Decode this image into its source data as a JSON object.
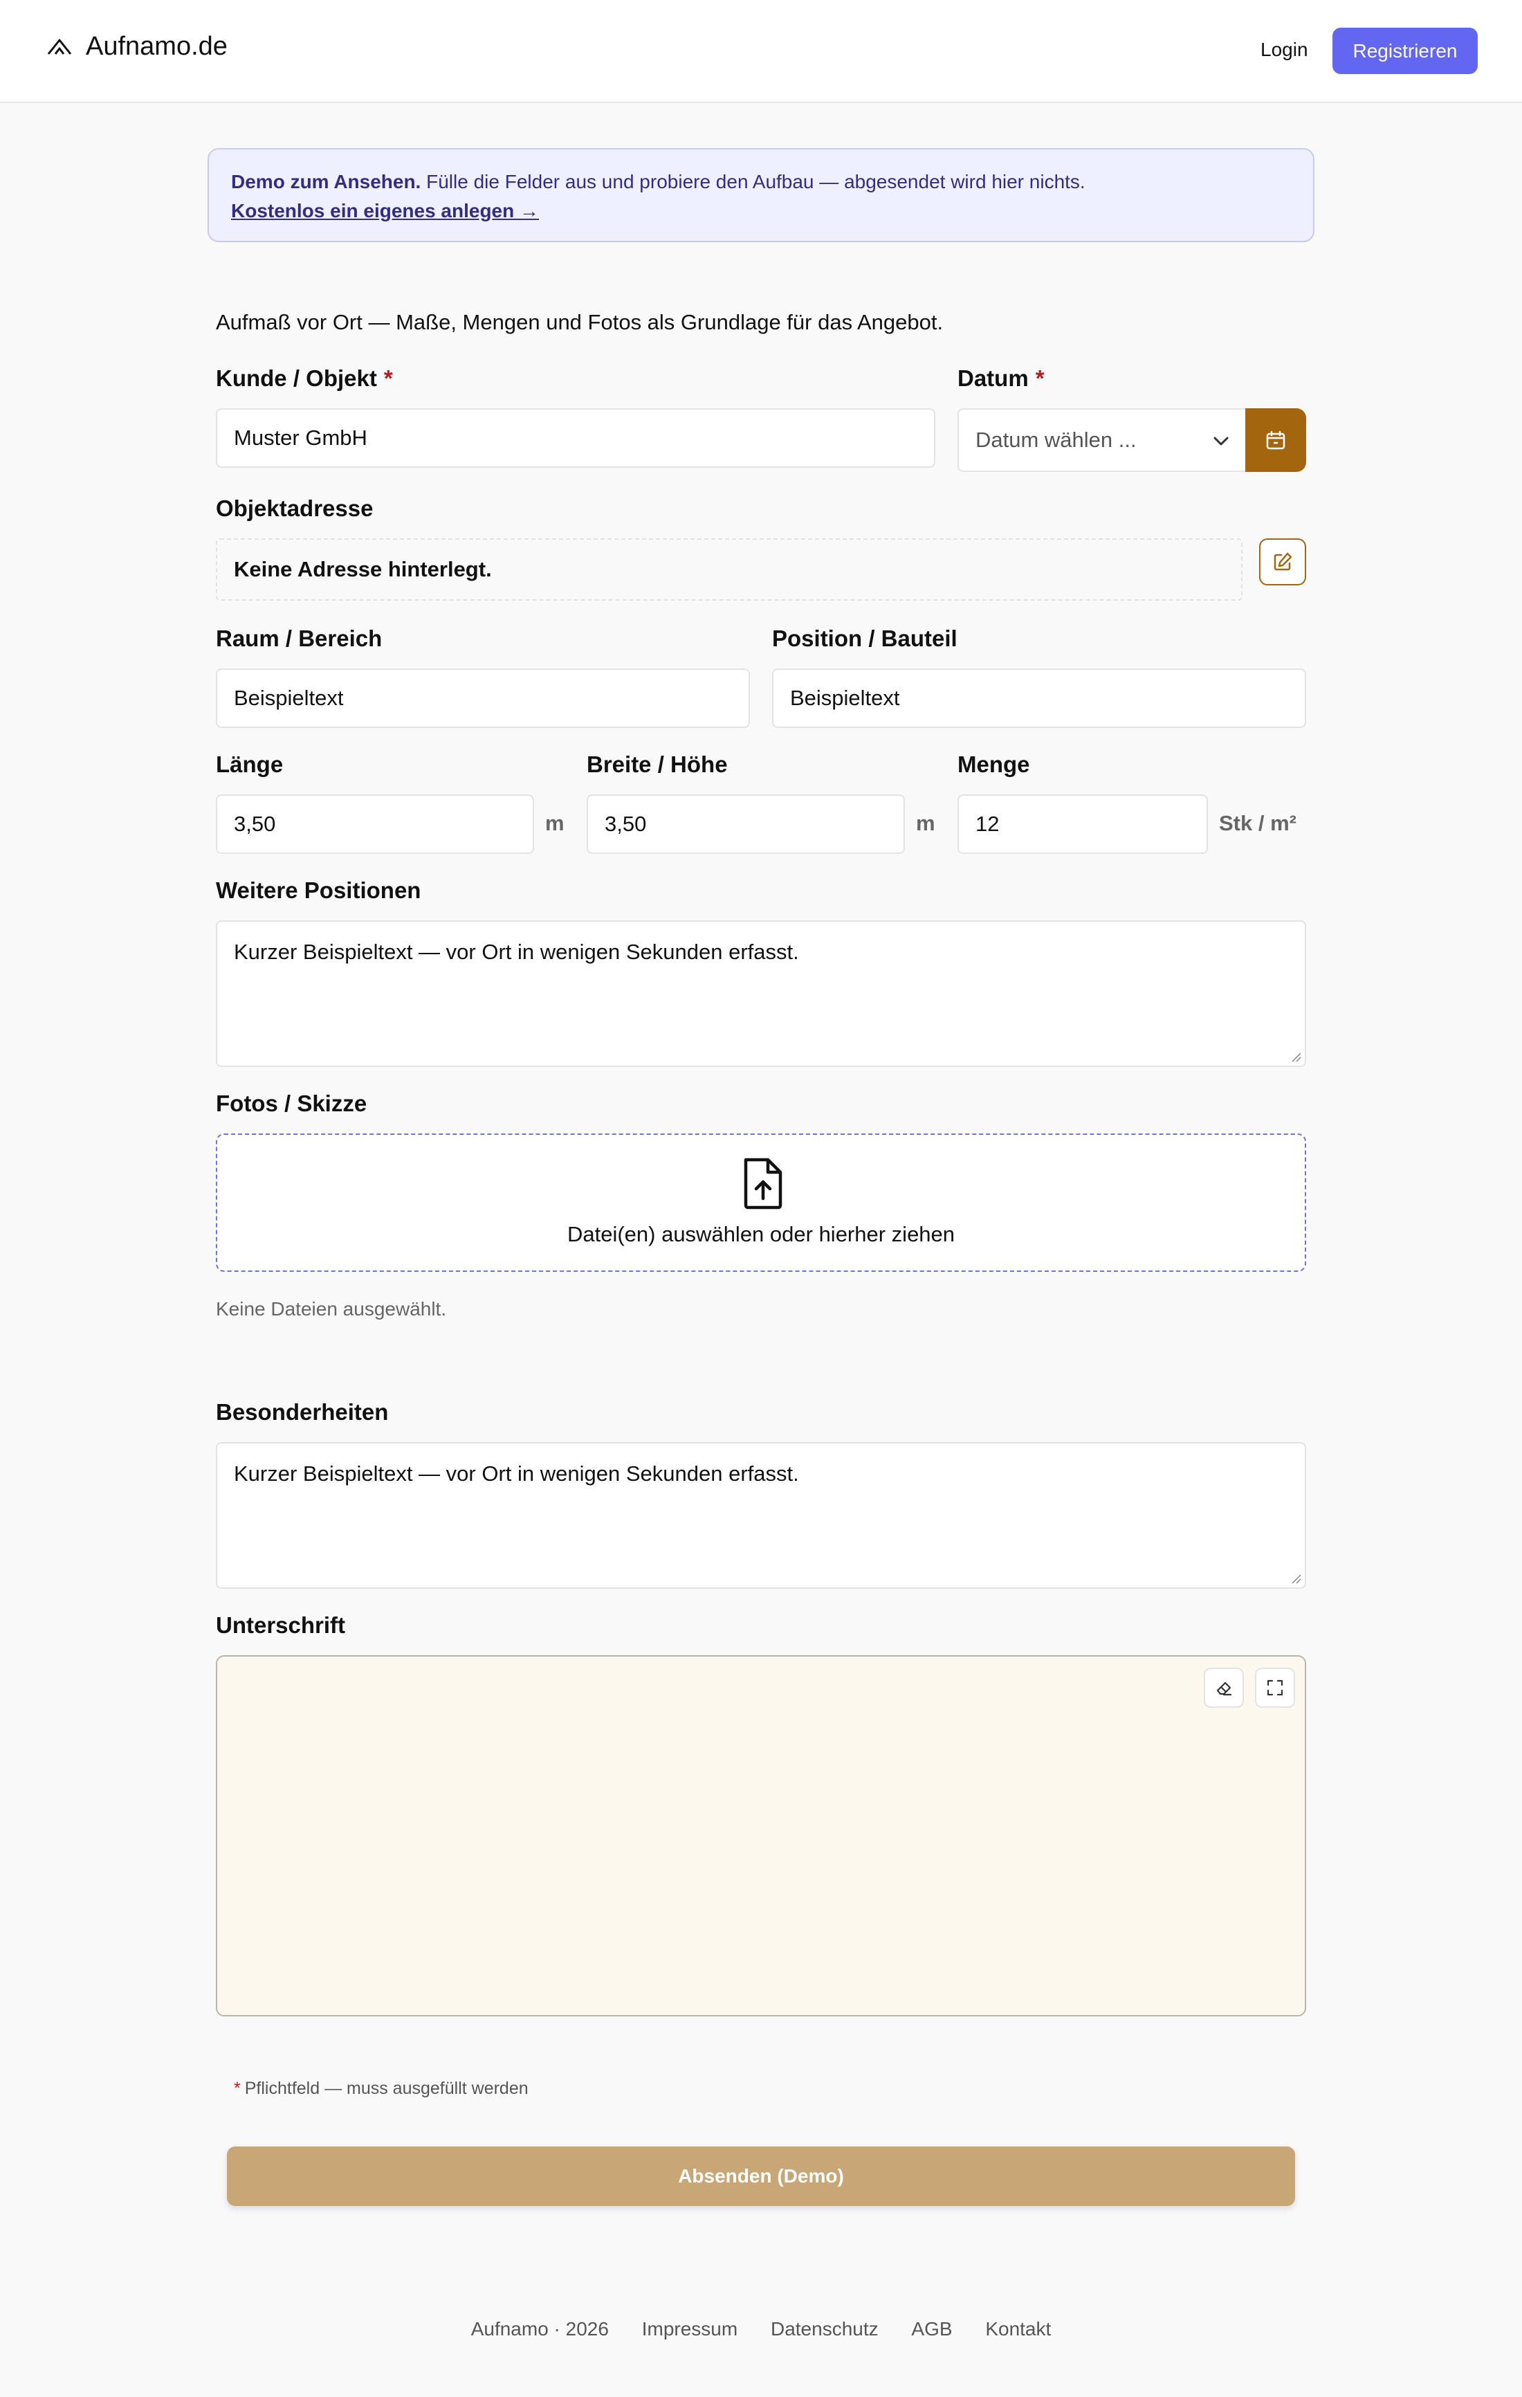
{
  "header": {
    "brand": "Aufnamo.de",
    "login_label": "Login",
    "register_label": "Registrieren"
  },
  "banner": {
    "bold": "Demo zum Ansehen.",
    "text": " Fülle die Felder aus und probiere den Aufbau — abgesendet wird hier nichts.",
    "link": "Kostenlos ein eigenes anlegen →"
  },
  "form": {
    "intro": "Aufmaß vor Ort — Maße, Mengen und Fotos als Grundlage für das Angebot.",
    "required_mark": "*",
    "customer": {
      "label": "Kunde / Objekt",
      "value": "Muster GmbH"
    },
    "date": {
      "label": "Datum",
      "placeholder": "Datum wählen ..."
    },
    "address": {
      "label": "Objektadresse",
      "value": "Keine Adresse hinterlegt."
    },
    "room": {
      "label": "Raum / Bereich",
      "value": "Beispieltext"
    },
    "position": {
      "label": "Position / Bauteil",
      "value": "Beispieltext"
    },
    "length": {
      "label": "Länge",
      "value": "3,50",
      "unit": "m"
    },
    "width": {
      "label": "Breite / Höhe",
      "value": "3,50",
      "unit": "m"
    },
    "quantity": {
      "label": "Menge",
      "value": "12",
      "unit": "Stk / m²"
    },
    "more_positions": {
      "label": "Weitere Positionen",
      "value": "Kurzer Beispieltext — vor Ort in wenigen Sekunden erfasst."
    },
    "photos": {
      "label": "Fotos / Skizze",
      "dropzone_text": "Datei(en) auswählen oder hierher ziehen",
      "status": "Keine Dateien ausgewählt."
    },
    "notes": {
      "label": "Besonderheiten",
      "value": "Kurzer Beispieltext — vor Ort in wenigen Sekunden erfasst."
    },
    "signature": {
      "label": "Unterschrift"
    },
    "required_note": "Pflichtfeld — muss ausgefüllt werden",
    "submit_label": "Absenden (Demo)"
  },
  "footer": {
    "copyright": "Aufnamo · 2026",
    "links": [
      "Impressum",
      "Datenschutz",
      "AGB",
      "Kontakt"
    ]
  },
  "colors": {
    "accent": "#6366f1",
    "brand_brown": "#a3660e",
    "submit": "#c9a676",
    "banner_bg": "#eef0ff",
    "signature_bg": "#fcf8ee",
    "required": "#b91c1c"
  },
  "icons": [
    "logo-icon",
    "chevron-down-icon",
    "calendar-icon",
    "edit-icon",
    "file-upload-icon",
    "eraser-icon",
    "fullscreen-icon",
    "resize-grip-icon"
  ]
}
